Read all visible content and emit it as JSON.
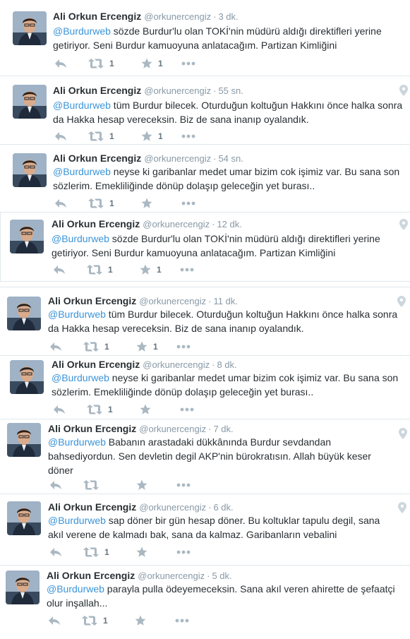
{
  "colors": {
    "mention": "#3b94d9",
    "meta": "#8899a6",
    "icon": "#aab8c2"
  },
  "icons": {
    "reply": "reply-icon",
    "retweet": "retweet-icon",
    "favorite": "star-icon",
    "more": "more-icon",
    "location": "location-pin-icon"
  },
  "tweets": [
    {
      "name": "Ali Orkun Ercengiz",
      "handle": "@orkunercengiz",
      "time": "3 dk.",
      "mention": "@Burdurweb",
      "text": " sözde Burdur'lu olan TOKİ'nin müdürü aldığı direktifleri yerine getiriyor. Seni Burdur kamuoyuna anlatacağım. Partizan Kimliğini",
      "retweets": "1",
      "favorites": "1"
    },
    {
      "name": "Ali Orkun Ercengiz",
      "handle": "@orkunercengiz",
      "time": "55 sn.",
      "mention": "@Burdurweb",
      "text": " tüm Burdur bilecek. Oturduğun koltuğun Hakkını önce halka sonra da Hakka hesap vereceksin. Biz de sana inanıp oyalandık.",
      "retweets": "1",
      "favorites": "1"
    },
    {
      "name": "Ali Orkun Ercengiz",
      "handle": "@orkunercengiz",
      "time": "54 sn.",
      "mention": "@Burdurweb",
      "text": " neyse ki garibanlar medet umar bizim cok işimiz var. Bu sana son sözlerim. Emekliliğinde dönüp dolaşıp geleceğin yet burası..",
      "retweets": "1",
      "favorites": ""
    },
    {
      "name": "Ali Orkun Ercengiz",
      "handle": "@orkunercengiz",
      "time": "12 dk.",
      "mention": "@Burdurweb",
      "text": " sözde Burdur'lu olan TOKİ'nin müdürü aldığı direktifleri yerine getiriyor. Seni Burdur kamuoyuna anlatacağım. Partizan Kimliğini",
      "retweets": "1",
      "favorites": "1"
    },
    {
      "name": "Ali Orkun Ercengiz",
      "handle": "@orkunercengiz",
      "time": "11 dk.",
      "mention": "@Burdurweb",
      "text": " tüm Burdur bilecek. Oturduğun koltuğun Hakkını önce halka sonra da Hakka hesap vereceksin. Biz de sana inanıp oyalandık.",
      "retweets": "1",
      "favorites": "1"
    },
    {
      "name": "Ali Orkun Ercengiz",
      "handle": "@orkunercengiz",
      "time": "8 dk.",
      "mention": "@Burdurweb",
      "text": " neyse ki garibanlar medet umar bizim cok işimiz var. Bu sana son sözlerim. Emekliliğinde dönüp dolaşıp geleceğin yet burası..",
      "retweets": "1",
      "favorites": ""
    },
    {
      "name": "Ali Orkun Ercengiz",
      "handle": "@orkunercengiz",
      "time": "7 dk.",
      "mention": "@Burdurweb",
      "text": " Babanın arastadaki dükkânında Burdur sevdandan bahsediyordun. Sen devletin degil AKP'nin bürokratısın. Allah büyük keser döner",
      "retweets": "",
      "favorites": ""
    },
    {
      "name": "Ali Orkun Ercengiz",
      "handle": "@orkunercengiz",
      "time": "6 dk.",
      "mention": "@Burdurweb",
      "text": " sap döner bir gün hesap döner. Bu koltuklar tapulu degil, sana akıl verene de kalmadı bak, sana da kalmaz. Garibanların vebalini",
      "retweets": "1",
      "favorites": ""
    },
    {
      "name": "Ali Orkun Ercengiz",
      "handle": "@orkunercengiz",
      "time": "5 dk.",
      "mention": "@Burdurweb",
      "text": " parayla pulla ödeyemeceksin. Sana akıl veren ahirette de şefaatçi olur inşallah...",
      "retweets": "1",
      "favorites": ""
    }
  ]
}
